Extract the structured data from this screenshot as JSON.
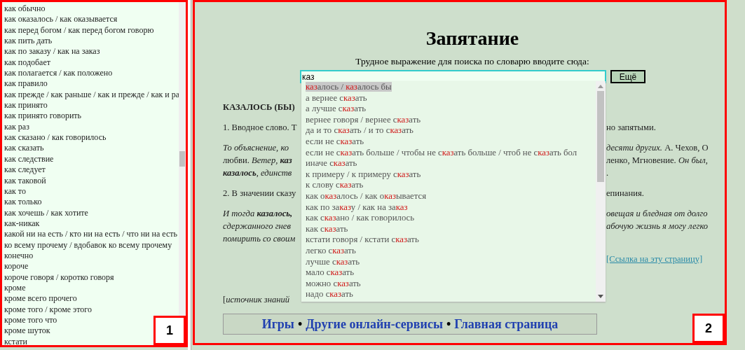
{
  "sidebar": {
    "items": [
      {
        "label": "как обычно"
      },
      {
        "label": "как оказалось / как оказывается"
      },
      {
        "label": "как перед богом / как перед богом говорю"
      },
      {
        "label": "как пить дать"
      },
      {
        "label": "как по заказу / как на заказ"
      },
      {
        "label": "как подобает"
      },
      {
        "label": "как полагается / как положено"
      },
      {
        "label": "как правило"
      },
      {
        "label": "как прежде / как раньше / как и прежде / как и ра"
      },
      {
        "label": "как принято"
      },
      {
        "label": "как принято говорить"
      },
      {
        "label": "как раз"
      },
      {
        "label": "как сказано / как говорилось"
      },
      {
        "label": "как сказать"
      },
      {
        "label": "как следствие"
      },
      {
        "label": "как следует"
      },
      {
        "label": "как таковой"
      },
      {
        "label": "как то"
      },
      {
        "label": "как только"
      },
      {
        "label": "как хочешь / как хотите"
      },
      {
        "label": "как-никак"
      },
      {
        "label": "какой ни на есть / кто ни на есть / что ни на есть"
      },
      {
        "label": "ко всему прочему / вдобавок ко всему прочему"
      },
      {
        "label": "конечно"
      },
      {
        "label": "короче"
      },
      {
        "label": "короче говоря / коротко говоря"
      },
      {
        "label": "кроме"
      },
      {
        "label": "кроме всего прочего"
      },
      {
        "label": "кроме того / кроме этого"
      },
      {
        "label": "кроме того что"
      },
      {
        "label": "кроме шуток"
      },
      {
        "label": "кстати"
      }
    ],
    "annotation": "1"
  },
  "main": {
    "title": "Запятание",
    "prompt": "Трудное выражение для поиска по словарю вводите сюда:",
    "search": {
      "value": "каз"
    },
    "button": "Ещё",
    "article": [
      {
        "kind": "heading",
        "left": [
          {
            "text": "КАЗАЛОСЬ (БЫ)",
            "kind": "bold"
          }
        ]
      },
      {
        "kind": "para",
        "left": [
          {
            "text": "1. Вводное слово. Т",
            "kind": "plain"
          }
        ],
        "right": [
          {
            "text": "но запятыми.",
            "kind": "plain"
          }
        ]
      },
      {
        "kind": "para",
        "left": [
          {
            "text": "То объяснение, ко",
            "kind": "italic"
          }
        ],
        "right": [
          {
            "text": "десяти других.",
            "kind": "italic"
          },
          {
            "text": " А. Чехов, О",
            "kind": "plain"
          }
        ]
      },
      {
        "kind": "cont",
        "left": [
          {
            "text": "любви. ",
            "kind": "plain"
          },
          {
            "text": "Ветер, ",
            "kind": "italic"
          },
          {
            "text": "каз",
            "kind": "bold_italic"
          }
        ],
        "right": [
          {
            "text": "ленко, Мгновение. ",
            "kind": "plain"
          },
          {
            "text": "Он был,",
            "kind": "italic"
          }
        ]
      },
      {
        "kind": "cont",
        "left": [
          {
            "text": "казалось",
            "kind": "bold_italic"
          },
          {
            "text": ", единств",
            "kind": "italic"
          }
        ],
        "right": [
          {
            "text": ".",
            "kind": "plain"
          }
        ]
      },
      {
        "kind": "para",
        "left": [
          {
            "text": "2. В значении сказу",
            "kind": "plain"
          }
        ],
        "right": [
          {
            "text": "епинания.",
            "kind": "plain"
          }
        ]
      },
      {
        "kind": "para",
        "left": [
          {
            "text": "И тогда ",
            "kind": "italic"
          },
          {
            "text": "казалось,",
            "kind": "bold_italic"
          }
        ],
        "right": [
          {
            "text": "овещая и бледная от долго",
            "kind": "italic"
          }
        ]
      },
      {
        "kind": "cont",
        "left": [
          {
            "text": "сдержанного гнев",
            "kind": "italic"
          }
        ],
        "right": [
          {
            "text": "абочую жизнь я могу легко",
            "kind": "italic"
          }
        ]
      },
      {
        "kind": "cont",
        "left": [
          {
            "text": "помирить со своим",
            "kind": "italic"
          }
        ]
      },
      {
        "kind": "link",
        "right": [
          {
            "text": "[Ссылка на эту страницу]",
            "kind": "plain"
          }
        ]
      },
      {
        "kind": "source",
        "left": [
          {
            "text": "[",
            "kind": "plain"
          },
          {
            "text": "источник знаний",
            "kind": "italic"
          }
        ]
      }
    ],
    "suggestions": [
      {
        "selected": true,
        "parts": [
          {
            "text": "каз",
            "match": true
          },
          {
            "text": "алось / ",
            "match": false
          },
          {
            "text": "каз",
            "match": true
          },
          {
            "text": "алось бы",
            "match": false
          }
        ]
      },
      {
        "selected": false,
        "parts": [
          {
            "text": "а вернее с",
            "match": false
          },
          {
            "text": "каз",
            "match": true
          },
          {
            "text": "ать",
            "match": false
          }
        ]
      },
      {
        "selected": false,
        "parts": [
          {
            "text": "а лучше с",
            "match": false
          },
          {
            "text": "каз",
            "match": true
          },
          {
            "text": "ать",
            "match": false
          }
        ]
      },
      {
        "selected": false,
        "parts": [
          {
            "text": "вернее говоря / вернее с",
            "match": false
          },
          {
            "text": "каз",
            "match": true
          },
          {
            "text": "ать",
            "match": false
          }
        ]
      },
      {
        "selected": false,
        "parts": [
          {
            "text": "да и то с",
            "match": false
          },
          {
            "text": "каз",
            "match": true
          },
          {
            "text": "ать / и то с",
            "match": false
          },
          {
            "text": "каз",
            "match": true
          },
          {
            "text": "ать",
            "match": false
          }
        ]
      },
      {
        "selected": false,
        "parts": [
          {
            "text": "если не с",
            "match": false
          },
          {
            "text": "каз",
            "match": true
          },
          {
            "text": "ать",
            "match": false
          }
        ]
      },
      {
        "selected": false,
        "parts": [
          {
            "text": "если не с",
            "match": false
          },
          {
            "text": "каз",
            "match": true
          },
          {
            "text": "ать больше / чтобы не с",
            "match": false
          },
          {
            "text": "каз",
            "match": true
          },
          {
            "text": "ать больше / чтоб не с",
            "match": false
          },
          {
            "text": "каз",
            "match": true
          },
          {
            "text": "ать бол",
            "match": false
          }
        ]
      },
      {
        "selected": false,
        "parts": [
          {
            "text": "иначе с",
            "match": false
          },
          {
            "text": "каз",
            "match": true
          },
          {
            "text": "ать",
            "match": false
          }
        ]
      },
      {
        "selected": false,
        "parts": [
          {
            "text": "к примеру / к примеру с",
            "match": false
          },
          {
            "text": "каз",
            "match": true
          },
          {
            "text": "ать",
            "match": false
          }
        ]
      },
      {
        "selected": false,
        "parts": [
          {
            "text": "к слову с",
            "match": false
          },
          {
            "text": "каз",
            "match": true
          },
          {
            "text": "ать",
            "match": false
          }
        ]
      },
      {
        "selected": false,
        "parts": [
          {
            "text": "как о",
            "match": false
          },
          {
            "text": "каз",
            "match": true
          },
          {
            "text": "алось / как о",
            "match": false
          },
          {
            "text": "каз",
            "match": true
          },
          {
            "text": "ывается",
            "match": false
          }
        ]
      },
      {
        "selected": false,
        "parts": [
          {
            "text": "как по за",
            "match": false
          },
          {
            "text": "каз",
            "match": true
          },
          {
            "text": "у / как на за",
            "match": false
          },
          {
            "text": "каз",
            "match": true
          }
        ]
      },
      {
        "selected": false,
        "parts": [
          {
            "text": "как с",
            "match": false
          },
          {
            "text": "каз",
            "match": true
          },
          {
            "text": "ано / как говорилось",
            "match": false
          }
        ]
      },
      {
        "selected": false,
        "parts": [
          {
            "text": "как с",
            "match": false
          },
          {
            "text": "каз",
            "match": true
          },
          {
            "text": "ать",
            "match": false
          }
        ]
      },
      {
        "selected": false,
        "parts": [
          {
            "text": "кстати говоря / кстати с",
            "match": false
          },
          {
            "text": "каз",
            "match": true
          },
          {
            "text": "ать",
            "match": false
          }
        ]
      },
      {
        "selected": false,
        "parts": [
          {
            "text": "легко с",
            "match": false
          },
          {
            "text": "каз",
            "match": true
          },
          {
            "text": "ать",
            "match": false
          }
        ]
      },
      {
        "selected": false,
        "parts": [
          {
            "text": "лучше с",
            "match": false
          },
          {
            "text": "каз",
            "match": true
          },
          {
            "text": "ать",
            "match": false
          }
        ]
      },
      {
        "selected": false,
        "parts": [
          {
            "text": "мало с",
            "match": false
          },
          {
            "text": "каз",
            "match": true
          },
          {
            "text": "ать",
            "match": false
          }
        ]
      },
      {
        "selected": false,
        "parts": [
          {
            "text": "можно с",
            "match": false
          },
          {
            "text": "каз",
            "match": true
          },
          {
            "text": "ать",
            "match": false
          }
        ]
      },
      {
        "selected": false,
        "parts": [
          {
            "text": "надо с",
            "match": false
          },
          {
            "text": "каз",
            "match": true
          },
          {
            "text": "ать",
            "match": false
          }
        ]
      }
    ],
    "footer_links": [
      {
        "label": "Игры"
      },
      {
        "label": "Другие онлайн-сервисы"
      },
      {
        "label": "Главная страница"
      }
    ],
    "separator": "•",
    "annotation": "2"
  }
}
